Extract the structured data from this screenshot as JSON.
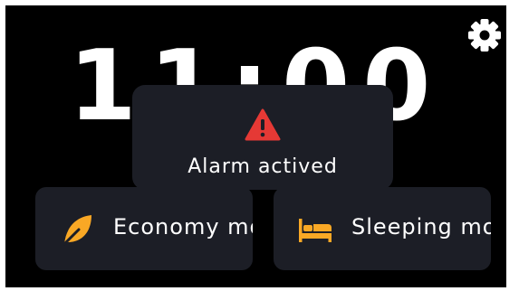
{
  "clock": {
    "time": "11:00"
  },
  "header": {
    "settings_icon": "gear-icon"
  },
  "alert": {
    "icon": "warning-icon",
    "icon_color": "#e53935",
    "message": "Alarm actived"
  },
  "modes": [
    {
      "label": "Economy mo",
      "icon": "leaf-icon",
      "icon_color": "#f9a825"
    },
    {
      "label": "Sleeping mo",
      "icon": "bed-icon",
      "icon_color": "#f9a825"
    }
  ],
  "colors": {
    "background": "#000000",
    "card": "#1c1e26",
    "text": "#ffffff",
    "accent": "#f9a825",
    "alert": "#e53935"
  }
}
